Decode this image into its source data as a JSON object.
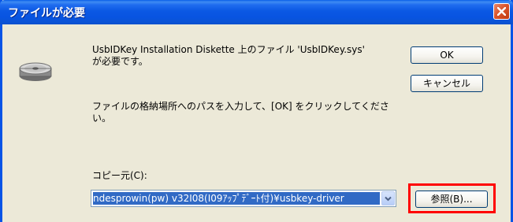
{
  "window": {
    "title": "ファイルが必要",
    "icons": {
      "close": "close-icon",
      "disk": "floppy-disk-icon",
      "dropdown": "chevron-down-icon"
    }
  },
  "dialog": {
    "message_line1": "UsbIDKey Installation Diskette 上のファイル 'UsbIDKey.sys'",
    "message_line2": "が必要です。",
    "instruction_line1": "ファイルの格納場所へのパスを入力して、[OK] をクリックしてくださ",
    "instruction_line2": "い。",
    "copy_source_label": "コピー元(C):",
    "copy_source_value": "ndesprowin(pw) v32I08(I09ｱｯﾌﾟﾃﾞｰﾄ付)¥usbkey-driver",
    "ok_label": "OK",
    "cancel_label": "キャンセル",
    "browse_label": "参照(B)..."
  },
  "colors": {
    "titlebar": "#0854e6",
    "dialog_bg": "#ece9d8",
    "selection": "#316ac5",
    "highlight_box": "#ff0000"
  }
}
